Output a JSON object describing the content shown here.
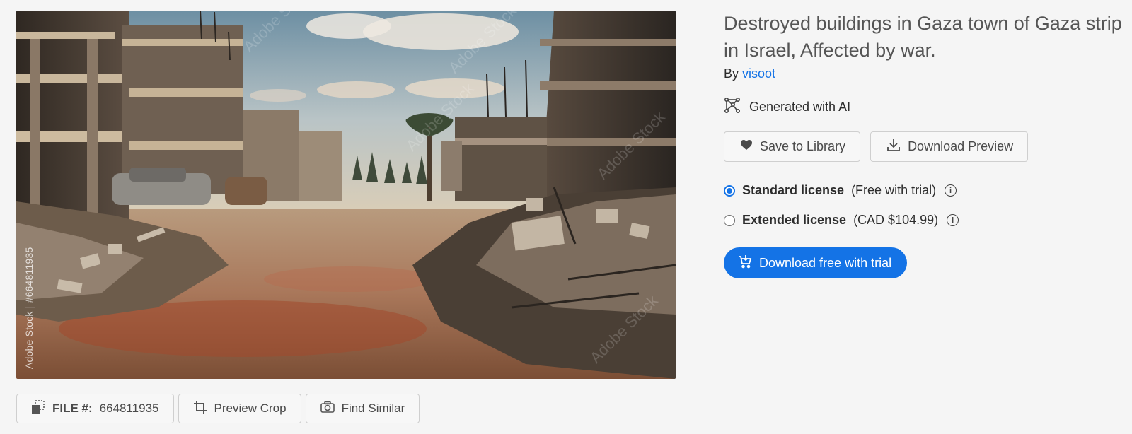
{
  "image": {
    "alt": "Destroyed buildings in Gaza town of Gaza strip in Israel, Affected by war.",
    "watermark_vertical": "Adobe Stock | #664811935",
    "watermark_diagonal": "Adobe Stock"
  },
  "toolbar": {
    "file_label": "FILE #:",
    "file_number": "664811935",
    "preview_crop_label": "Preview Crop",
    "find_similar_label": "Find Similar"
  },
  "asset": {
    "title": "Destroyed buildings in Gaza town of Gaza strip in Israel, Affected by war.",
    "by_prefix": "By",
    "author": "visoot",
    "ai_badge": "Generated with AI"
  },
  "actions": {
    "save_label": "Save to Library",
    "download_preview_label": "Download Preview"
  },
  "licenses": [
    {
      "name": "Standard license",
      "note": "(Free with trial)",
      "selected": true
    },
    {
      "name": "Extended license",
      "note": "(CAD $104.99)",
      "selected": false
    }
  ],
  "cta": {
    "label": "Download free with trial"
  },
  "colors": {
    "accent": "#1473e6",
    "background": "#f5f5f5",
    "border": "#cfcfcf"
  }
}
